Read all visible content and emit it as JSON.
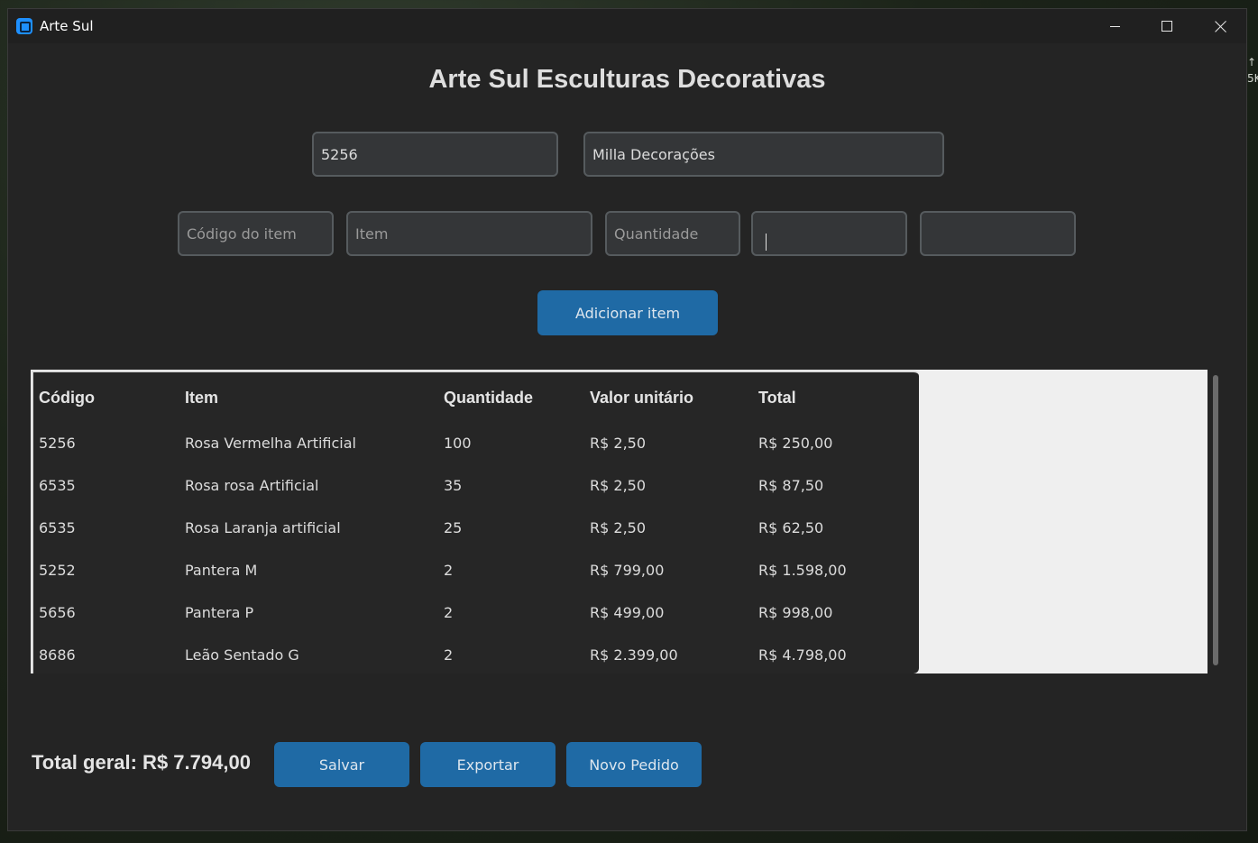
{
  "window": {
    "title": "Arte Sul"
  },
  "desktop_edge_text": [
    "↑",
    "5K"
  ],
  "heading": "Arte Sul Esculturas Decorativas",
  "order": {
    "number": "5256",
    "client": "Milla Decorações"
  },
  "item_form": {
    "code_placeholder": "Código do item",
    "item_placeholder": "Item",
    "quantity_placeholder": "Quantidade",
    "unit_price": "",
    "total": ""
  },
  "add_button": "Adicionar item",
  "table": {
    "headers": [
      "Código",
      "Item",
      "Quantidade",
      "Valor unitário",
      "Total"
    ],
    "rows": [
      [
        "5256",
        "Rosa Vermelha Artificial",
        "100",
        "R$ 2,50",
        "R$ 250,00"
      ],
      [
        "6535",
        "Rosa rosa Artificial",
        "35",
        "R$ 2,50",
        "R$ 87,50"
      ],
      [
        "6535",
        "Rosa Laranja artificial",
        "25",
        "R$ 2,50",
        "R$ 62,50"
      ],
      [
        "5252",
        "Pantera M",
        "2",
        "R$ 799,00",
        "R$ 1.598,00"
      ],
      [
        "5656",
        "Pantera P",
        "2",
        "R$ 499,00",
        "R$ 998,00"
      ],
      [
        "8686",
        "Leão Sentado G",
        "2",
        "R$ 2.399,00",
        "R$ 4.798,00"
      ]
    ]
  },
  "grand_total": "Total geral: R$ 7.794,00",
  "actions": {
    "save": "Salvar",
    "export": "Exportar",
    "new_order": "Novo Pedido"
  },
  "colors": {
    "accent": "#1f6aa5",
    "window_bg": "#242424",
    "field_bg": "#343638"
  }
}
